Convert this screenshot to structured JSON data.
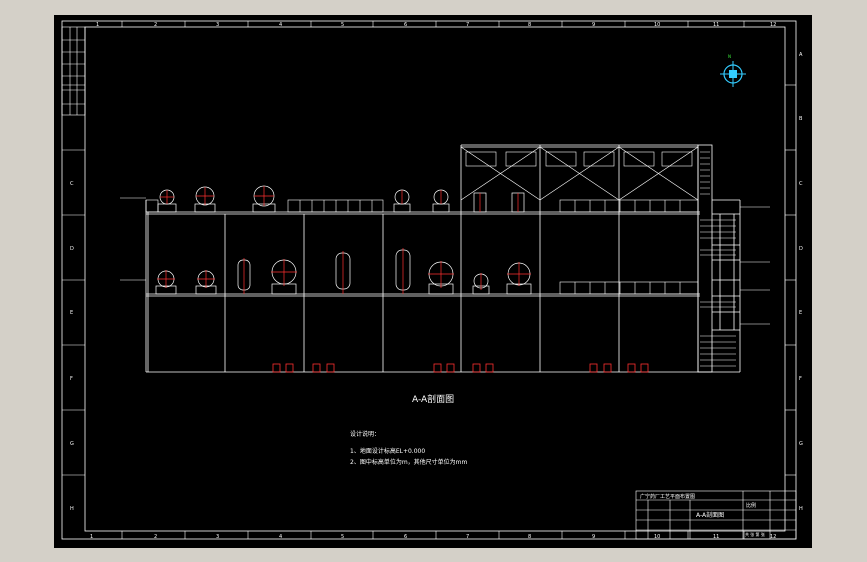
{
  "drawing": {
    "view_title": "A-A剖面图",
    "notes_title": "设计说明：",
    "notes": [
      "1、地面设计标高EL+0.000",
      "2、图中标高单位为m，其他尺寸单位为mm"
    ],
    "column_numbers": [
      "1",
      "2",
      "3",
      "4",
      "5",
      "6",
      "7",
      "8",
      "9",
      "10",
      "11",
      "12"
    ],
    "row_letters": [
      "A",
      "B",
      "C",
      "D",
      "E",
      "F",
      "G",
      "H"
    ],
    "title_block": {
      "company": "广宁药厂工艺平面布置图",
      "drawing_name": "A-A剖面图",
      "scale_label": "比例",
      "sheet_label": "共 张 第 张"
    },
    "colors": {
      "background": "#000000",
      "lines": "#ffffff",
      "labels": "#3cf03c",
      "accent": "#ff3030",
      "compass": "#33ccff"
    },
    "icons": {
      "compass": "north-arrow-icon"
    }
  }
}
